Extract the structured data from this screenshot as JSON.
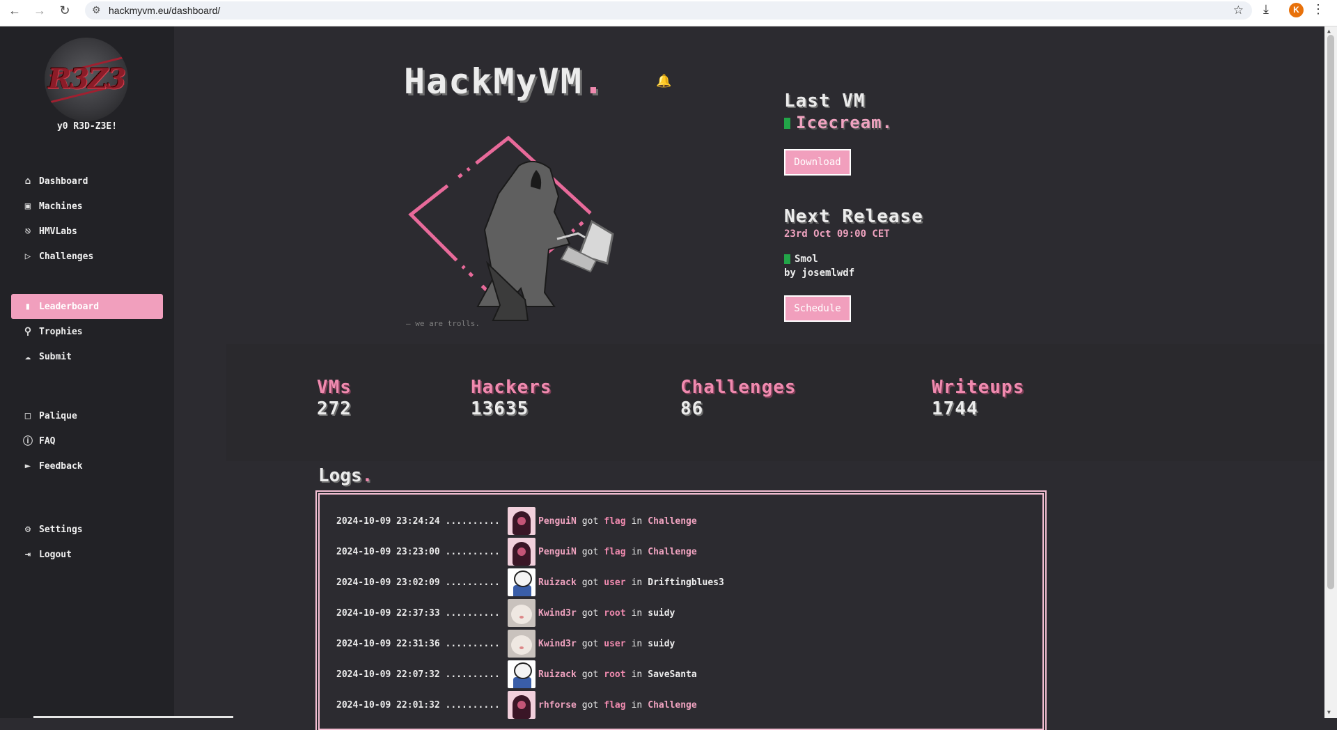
{
  "browser": {
    "url": "hackmyvm.eu/dashboard/",
    "profile_initial": "K"
  },
  "sidebar": {
    "greeting": "y0 R3D-Z3E!",
    "avatar_text": "R3Z3",
    "groups": [
      [
        {
          "label": "Dashboard",
          "icon": "home-icon"
        },
        {
          "label": "Machines",
          "icon": "cpu-icon"
        },
        {
          "label": "HMVLabs",
          "icon": "gamepad-icon"
        },
        {
          "label": "Challenges",
          "icon": "tag-icon"
        }
      ],
      [
        {
          "label": "Leaderboard",
          "icon": "bar-chart-icon",
          "active": true
        },
        {
          "label": "Trophies",
          "icon": "trophy-icon"
        },
        {
          "label": "Submit",
          "icon": "upload-cloud-icon"
        }
      ],
      [
        {
          "label": "Palique",
          "icon": "chat-icon"
        },
        {
          "label": "FAQ",
          "icon": "help-circle-icon"
        },
        {
          "label": "Feedback",
          "icon": "megaphone-icon"
        }
      ],
      [
        {
          "label": "Settings",
          "icon": "gear-icon"
        },
        {
          "label": "Logout",
          "icon": "logout-icon"
        }
      ]
    ]
  },
  "hero": {
    "title": "HackMyVM",
    "title_dot": ".",
    "tagline": "— we are trolls."
  },
  "last_vm": {
    "heading": "Last VM",
    "name": "Icecream.",
    "download_label": "Download"
  },
  "next_release": {
    "heading": "Next Release",
    "date": "23rd Oct 09:00 CET",
    "vm_name": "Smol",
    "author": "by josemlwdf",
    "schedule_label": "Schedule"
  },
  "stats": [
    {
      "label": "VMs",
      "value": "272"
    },
    {
      "label": "Hackers",
      "value": "13635"
    },
    {
      "label": "Challenges",
      "value": "86"
    },
    {
      "label": "Writeups",
      "value": "1744"
    }
  ],
  "logs": {
    "title": "Logs",
    "title_dot": ".",
    "entries": [
      {
        "time": "2024-10-09 23:24:24 ..........",
        "avatar": "penguin",
        "user": "PenguiN",
        "got": "got",
        "type": "flag",
        "in": "in",
        "target": "Challenge",
        "target_pink": true
      },
      {
        "time": "2024-10-09 23:23:00 ..........",
        "avatar": "penguin",
        "user": "PenguiN",
        "got": "got",
        "type": "flag",
        "in": "in",
        "target": "Challenge",
        "target_pink": true
      },
      {
        "time": "2024-10-09 23:02:09 ..........",
        "avatar": "sans",
        "user": "Ruizack",
        "got": "got",
        "type": "user",
        "in": "in",
        "target": "Driftingblues3",
        "target_pink": false
      },
      {
        "time": "2024-10-09 22:37:33 ..........",
        "avatar": "cat",
        "user": "Kwind3r",
        "got": "got",
        "type": "root",
        "in": "in",
        "target": "suidy",
        "target_pink": false
      },
      {
        "time": "2024-10-09 22:31:36 ..........",
        "avatar": "cat",
        "user": "Kwind3r",
        "got": "got",
        "type": "user",
        "in": "in",
        "target": "suidy",
        "target_pink": false
      },
      {
        "time": "2024-10-09 22:07:32 ..........",
        "avatar": "sans",
        "user": "Ruizack",
        "got": "got",
        "type": "root",
        "in": "in",
        "target": "SaveSanta",
        "target_pink": false
      },
      {
        "time": "2024-10-09 22:01:32 ..........",
        "avatar": "penguin",
        "user": "rhforse",
        "got": "got",
        "type": "flag",
        "in": "in",
        "target": "Challenge",
        "target_pink": true
      }
    ]
  },
  "colors": {
    "accent_pink": "#f19fbd",
    "background": "#2c2b30",
    "sidebar": "#222226",
    "status_green": "#22a548"
  }
}
